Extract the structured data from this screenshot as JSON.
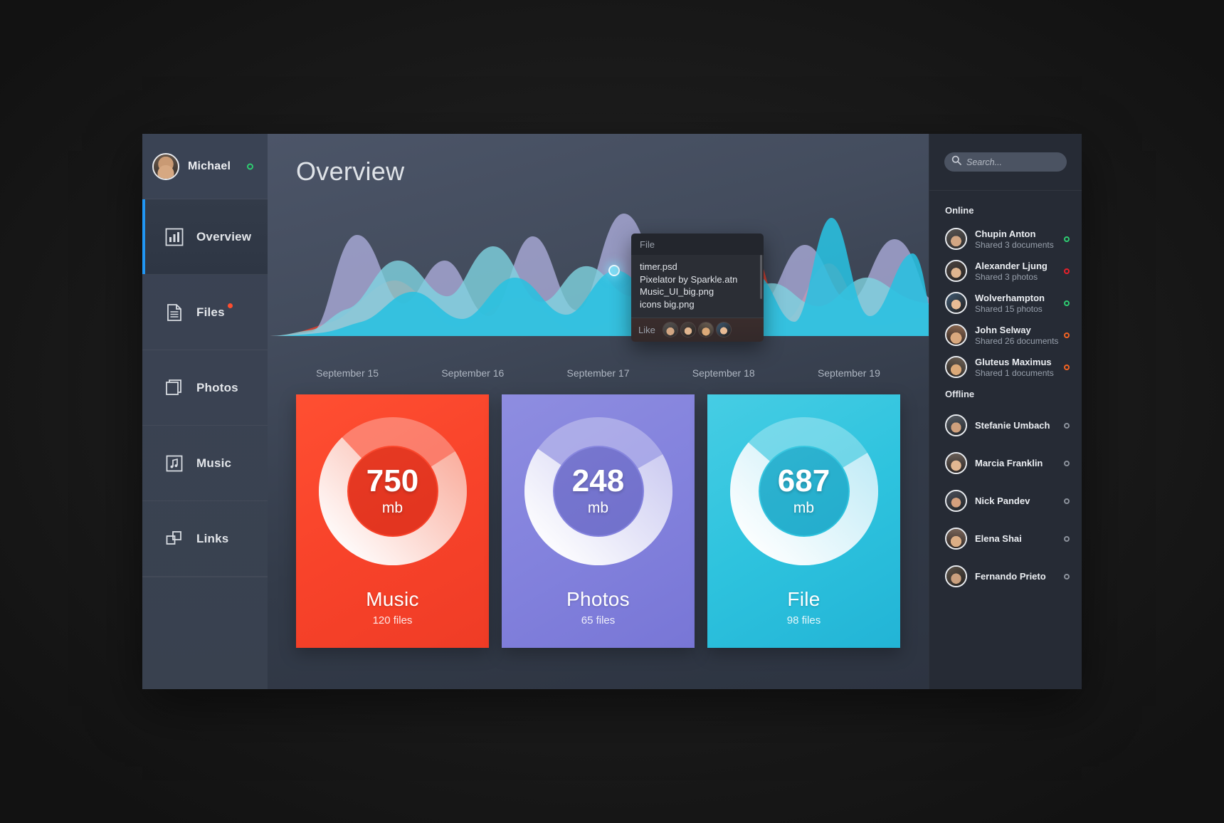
{
  "sidebar": {
    "user": {
      "name": "Michael",
      "status_color": "#2ecc71"
    },
    "items": [
      {
        "label": "Overview",
        "icon": "bar-chart-icon",
        "active": true,
        "badge": false
      },
      {
        "label": "Files",
        "icon": "document-icon",
        "active": false,
        "badge": true
      },
      {
        "label": "Photos",
        "icon": "photos-icon",
        "active": false,
        "badge": false
      },
      {
        "label": "Music",
        "icon": "music-note-icon",
        "active": false,
        "badge": false
      },
      {
        "label": "Links",
        "icon": "links-icon",
        "active": false,
        "badge": false
      }
    ],
    "badge_color": "#ff4d2e",
    "active_indicator_color": "#2196f3"
  },
  "main": {
    "title": "Overview",
    "dates": [
      "September 15",
      "September 16",
      "September 17",
      "September 18",
      "September 19"
    ],
    "tooltip": {
      "header": "File",
      "files": [
        "timer.psd",
        "Pixelator by Sparkle.atn",
        "Music_UI_big.png",
        "icons big.png"
      ],
      "like_label": "Like",
      "like_count": 4
    },
    "cards": [
      {
        "value": "750",
        "unit": "mb",
        "title": "Music",
        "files": "120 files",
        "color": "#f8432a",
        "percent": 72
      },
      {
        "value": "248",
        "unit": "mb",
        "title": "Photos",
        "files": "65 files",
        "color": "#8382dd",
        "percent": 68
      },
      {
        "value": "687",
        "unit": "mb",
        "title": "File",
        "files": "98 files",
        "color": "#2ec3de",
        "percent": 70
      }
    ]
  },
  "chart_data": {
    "type": "area",
    "title": "Overview",
    "xlabel": "",
    "ylabel": "",
    "categories": [
      "September 15",
      "September 16",
      "September 17",
      "September 18",
      "September 19"
    ],
    "grid": false,
    "legend": "none",
    "series": [
      {
        "name": "Purple",
        "color": "#b5b6e6",
        "values": [
          10,
          86,
          30,
          70,
          18,
          74,
          34,
          96,
          30,
          58,
          22,
          64,
          30,
          78,
          26
        ]
      },
      {
        "name": "Light Blue",
        "color": "#7fd3e0",
        "values": [
          4,
          20,
          62,
          40,
          70,
          26,
          56,
          30,
          64,
          24,
          40,
          18,
          36,
          22,
          50
        ]
      },
      {
        "name": "Cyan",
        "color": "#29c0e0",
        "values": [
          2,
          12,
          30,
          66,
          24,
          48,
          22,
          78,
          18,
          44,
          92,
          28,
          86,
          20,
          40
        ]
      },
      {
        "name": "Red",
        "color": "#e0412f",
        "values": [
          0,
          6,
          14,
          40,
          10,
          26,
          8,
          34,
          6,
          90,
          22,
          60,
          12,
          30,
          8
        ]
      }
    ],
    "highlight_point": {
      "x": "September 17",
      "color": "#7fdcf5"
    }
  },
  "right": {
    "search": {
      "placeholder": "Search...",
      "value": ""
    },
    "groups": [
      {
        "label": "Online",
        "contacts": [
          {
            "name": "Chupin Anton",
            "sub": "Shared 3 documents",
            "dot": "#2ecc71"
          },
          {
            "name": "Alexander Ljung",
            "sub": "Shared 3 photos",
            "dot": "#e8202a"
          },
          {
            "name": "Wolverhampton",
            "sub": "Shared 15 photos",
            "dot": "#2ecc71"
          },
          {
            "name": "John Selway",
            "sub": "Shared 26 documents",
            "dot": "#f26322"
          },
          {
            "name": "Gluteus Maximus",
            "sub": "Shared 1 documents",
            "dot": "#f26322"
          }
        ]
      },
      {
        "label": "Offline",
        "contacts": [
          {
            "name": "Stefanie Umbach",
            "sub": "",
            "dot": "#8b919b"
          },
          {
            "name": "Marcia Franklin",
            "sub": "",
            "dot": "#8b919b"
          },
          {
            "name": "Nick Pandev",
            "sub": "",
            "dot": "#8b919b"
          },
          {
            "name": "Elena Shai",
            "sub": "",
            "dot": "#8b919b"
          },
          {
            "name": "Fernando Prieto",
            "sub": "",
            "dot": "#8b919b"
          }
        ]
      }
    ]
  }
}
